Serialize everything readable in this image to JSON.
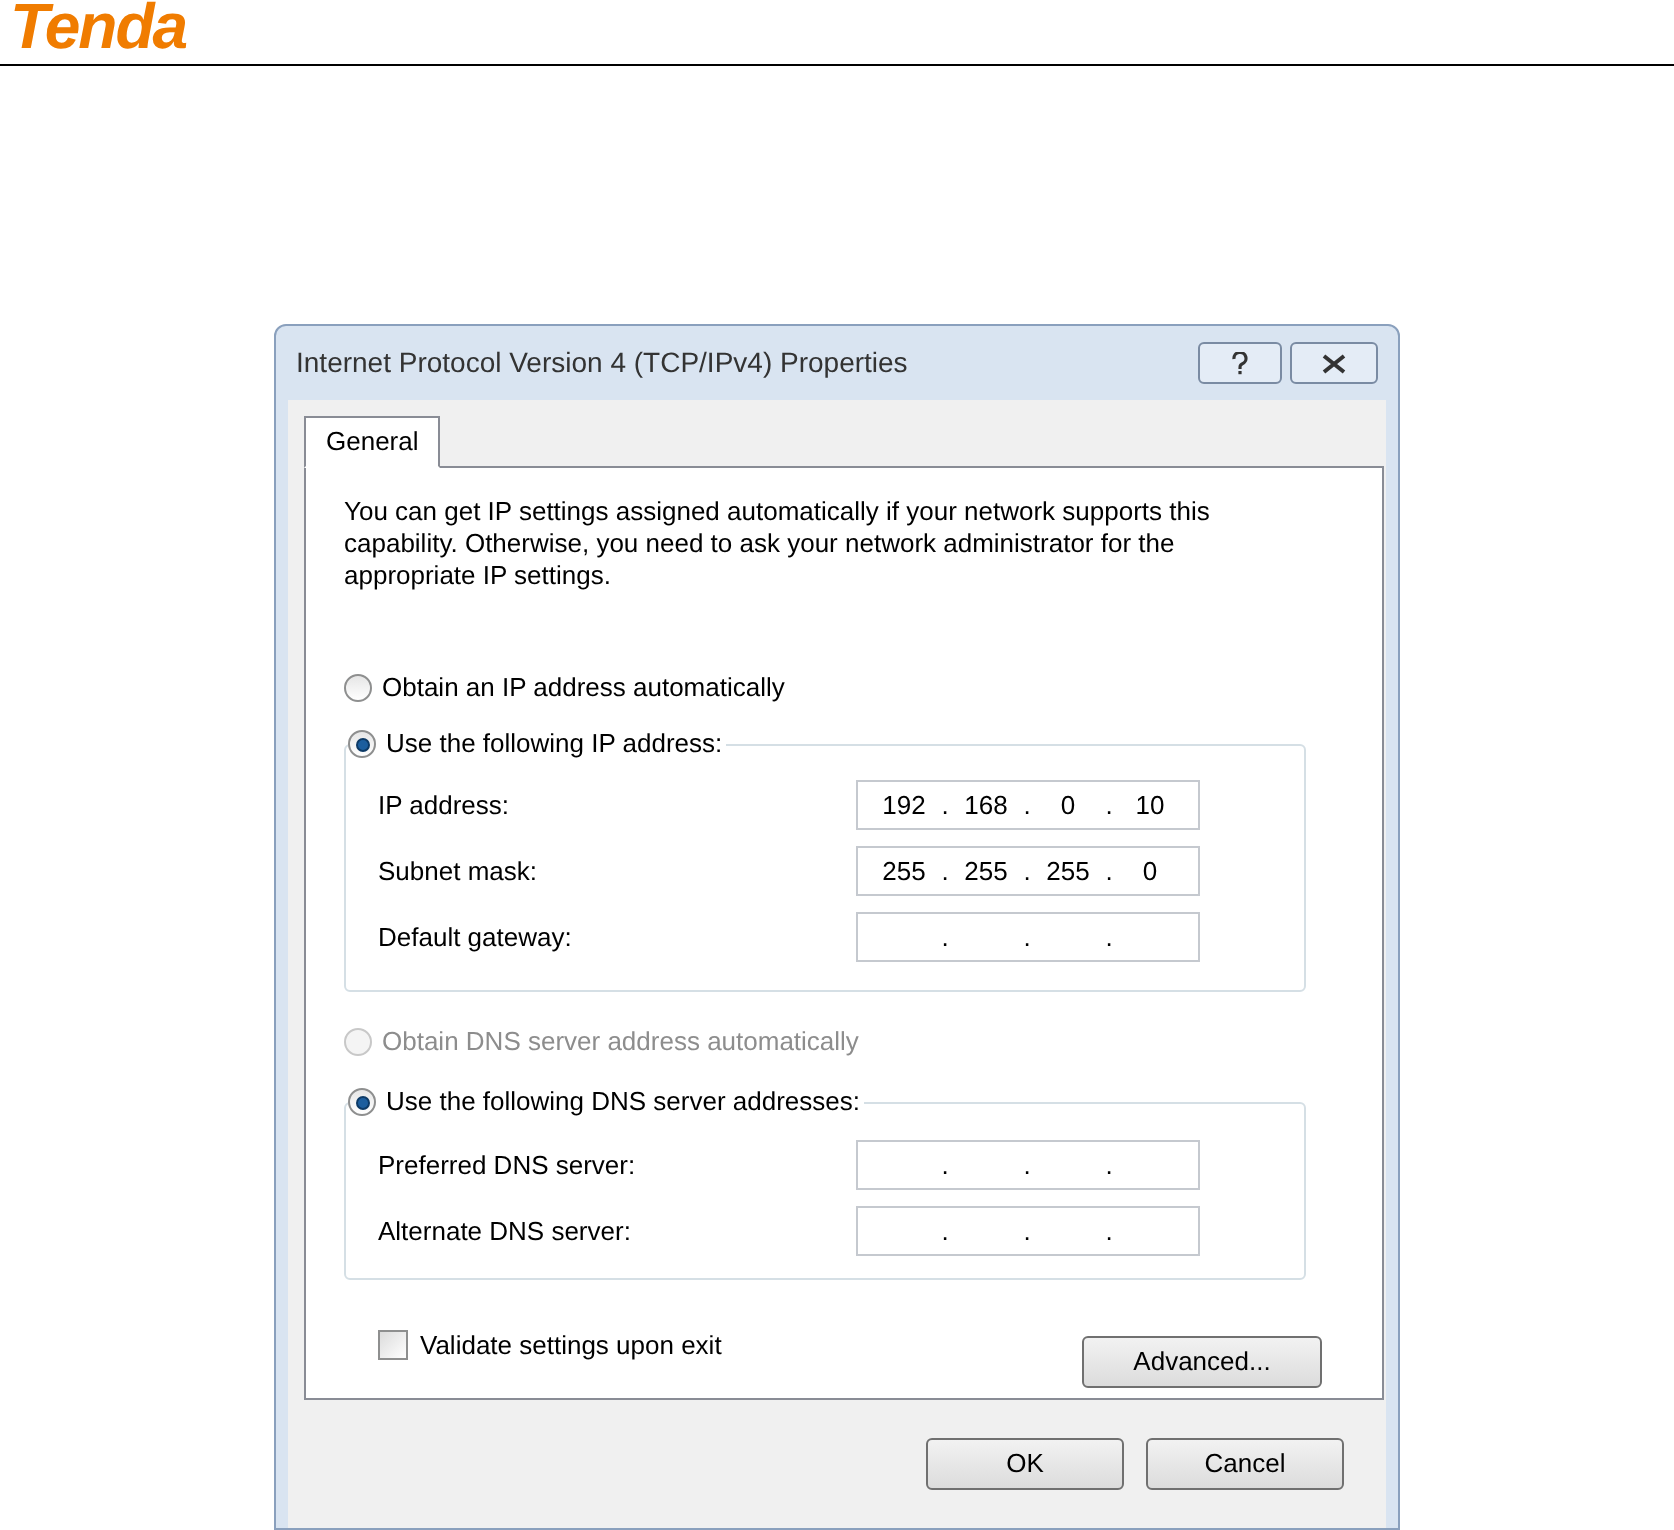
{
  "header": {
    "logo": "Tenda"
  },
  "dialog": {
    "title": "Internet Protocol Version 4 (TCP/IPv4) Properties",
    "tabs": [
      {
        "label": "General",
        "selected": true
      }
    ],
    "description": "You can get IP settings assigned automatically if your network supports this capability. Otherwise, you need to ask your network administrator for the appropriate IP settings.",
    "ip_options": [
      {
        "label": "Obtain an IP address automatically",
        "selected": false,
        "disabled": false
      },
      {
        "label": "Use the following IP address:",
        "selected": true,
        "disabled": false
      }
    ],
    "ip_fields": [
      {
        "label": "IP address:",
        "cells": [
          {
            "text": "192"
          },
          {
            "text": "."
          },
          {
            "text": "168"
          },
          {
            "text": "."
          },
          {
            "text": "0"
          },
          {
            "text": "."
          },
          {
            "text": "10"
          }
        ]
      },
      {
        "label": "Subnet mask:",
        "cells": [
          {
            "text": "255"
          },
          {
            "text": "."
          },
          {
            "text": "255"
          },
          {
            "text": "."
          },
          {
            "text": "255"
          },
          {
            "text": "."
          },
          {
            "text": "0"
          }
        ]
      },
      {
        "label": "Default gateway:",
        "cells": [
          {},
          {
            "text": "."
          },
          {},
          {
            "text": "."
          },
          {},
          {
            "text": "."
          },
          {}
        ]
      }
    ],
    "dns_options": [
      {
        "label": "Obtain DNS server address automatically",
        "selected": false,
        "disabled": true
      },
      {
        "label": "Use the following DNS server addresses:",
        "selected": true,
        "disabled": false
      }
    ],
    "dns_fields": [
      {
        "label": "Preferred DNS server:",
        "cells": [
          {},
          {
            "text": "."
          },
          {},
          {
            "text": "."
          },
          {},
          {
            "text": "."
          },
          {}
        ]
      },
      {
        "label": "Alternate DNS server:",
        "cells": [
          {},
          {
            "text": "."
          },
          {},
          {
            "text": "."
          },
          {},
          {
            "text": "."
          },
          {}
        ]
      }
    ],
    "validate": {
      "label": "Validate settings upon exit",
      "checked": false
    },
    "advanced_button": "Advanced...",
    "buttons": [
      "OK",
      "Cancel"
    ]
  }
}
